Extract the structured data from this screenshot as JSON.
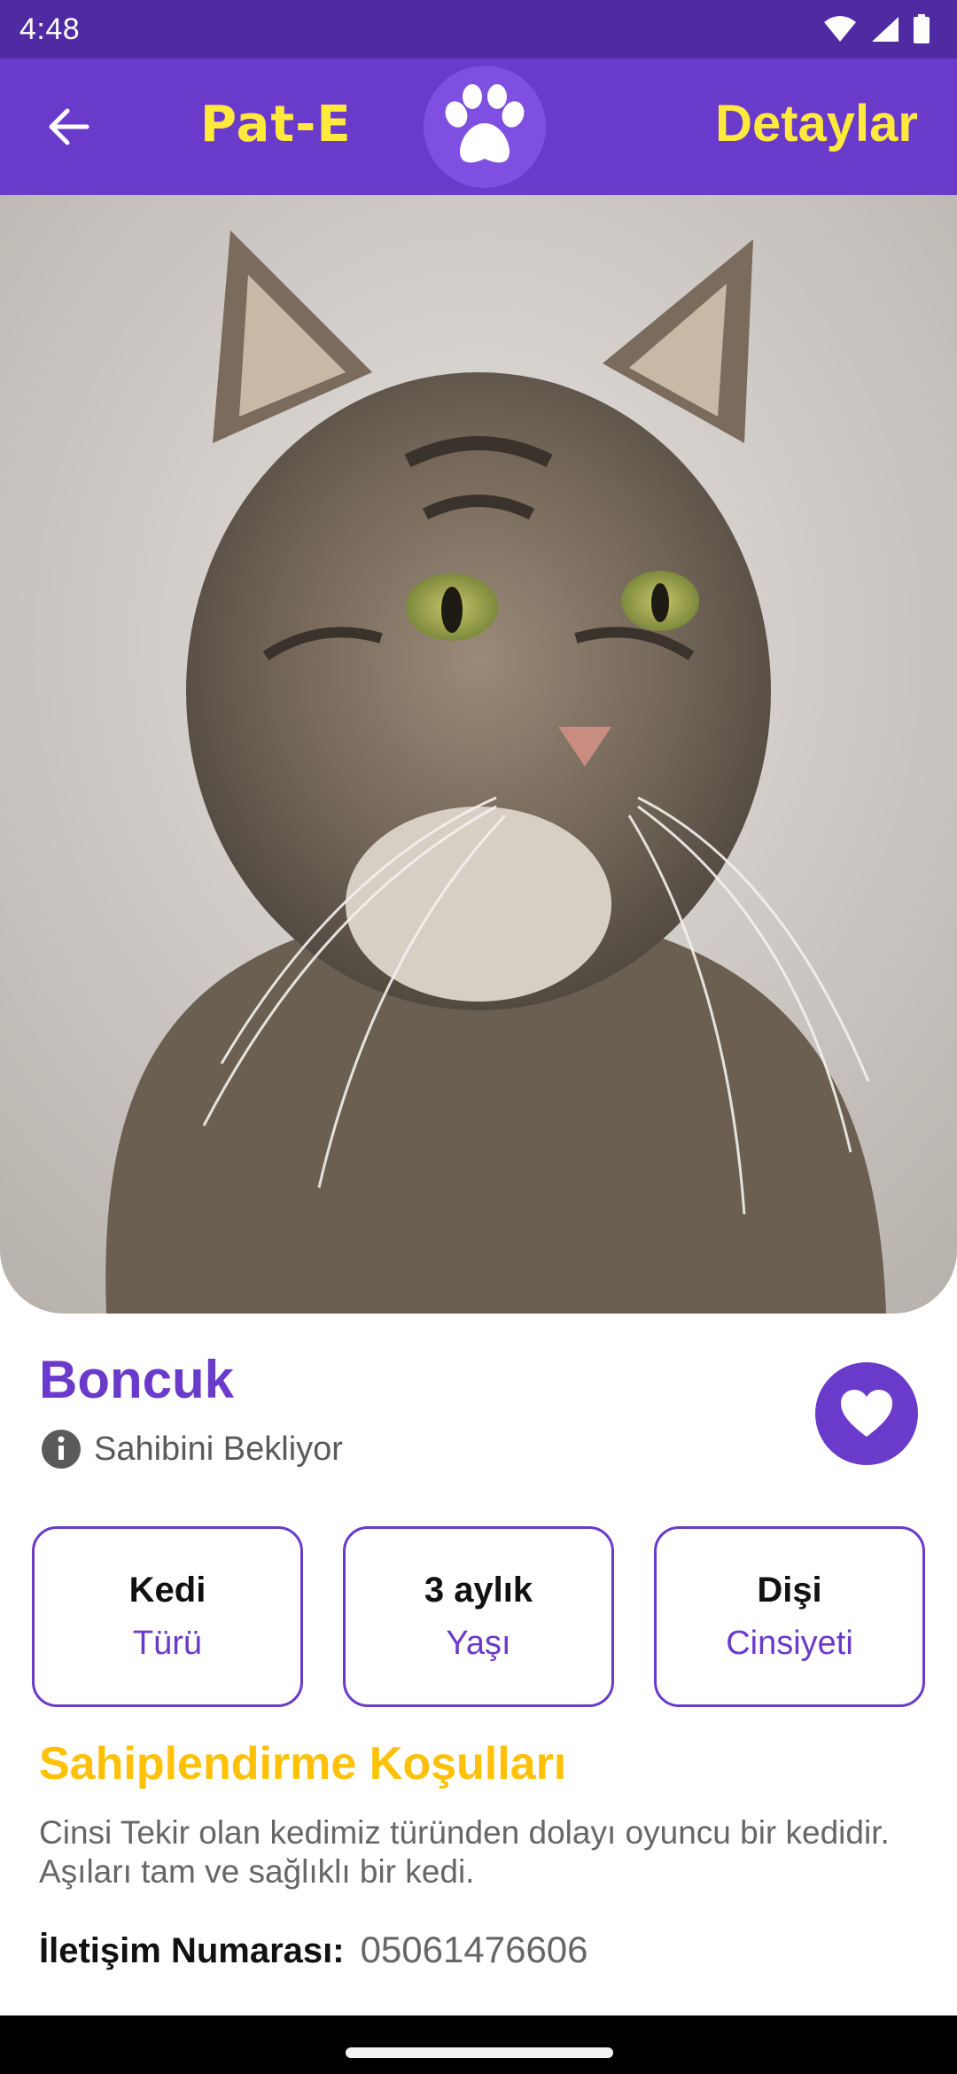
{
  "status_bar": {
    "time": "4:48",
    "icons": [
      "wifi-icon",
      "signal-icon",
      "battery-icon"
    ]
  },
  "app_bar": {
    "back_icon": "arrow-left-icon",
    "brand": "Pat-E",
    "logo_icon": "paw-icon",
    "title": "Detaylar"
  },
  "pet": {
    "photo_subject": "tabby-cat-photo",
    "name": "Boncuk",
    "status": "Sahibini Bekliyor",
    "status_icon": "info-icon",
    "favorite_icon": "heart-icon",
    "attributes": [
      {
        "value": "Kedi",
        "label": "Türü"
      },
      {
        "value": "3 aylık",
        "label": "Yaşı"
      },
      {
        "value": "Dişi",
        "label": "Cinsiyeti"
      }
    ]
  },
  "adoption": {
    "title": "Sahiplendirme Koşulları",
    "description": "Cinsi Tekir olan kedimiz türünden dolayı oyuncu bir kedidir. Aşıları tam ve sağlıklı bir kedi."
  },
  "contact": {
    "label": "İletişim Numarası:",
    "value": "05061476606"
  },
  "colors": {
    "primary": "#6A3ACB",
    "status_bar": "#4F2AA3",
    "brand_yellow": "#FFE93B",
    "section_title": "#FFC107"
  }
}
